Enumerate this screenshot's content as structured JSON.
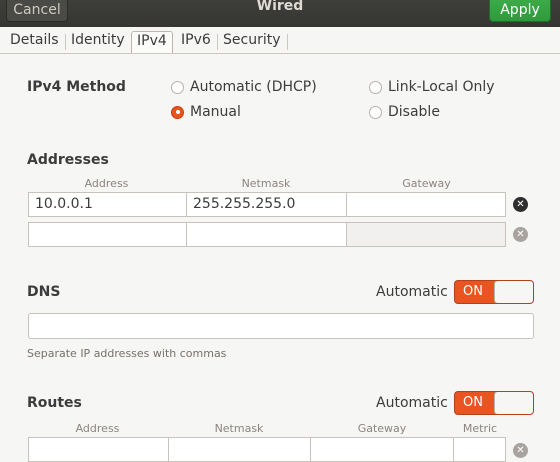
{
  "header": {
    "cancel_label": "Cancel",
    "title": "Wired",
    "apply_label": "Apply"
  },
  "tabs": [
    {
      "label": "Details"
    },
    {
      "label": "Identity"
    },
    {
      "label": "IPv4"
    },
    {
      "label": "IPv6"
    },
    {
      "label": "Security"
    }
  ],
  "active_tab": "IPv4",
  "ipv4_method": {
    "label": "IPv4 Method",
    "options": [
      {
        "label": "Automatic (DHCP)",
        "checked": false
      },
      {
        "label": "Link-Local Only",
        "checked": false
      },
      {
        "label": "Manual",
        "checked": true
      },
      {
        "label": "Disable",
        "checked": false
      }
    ]
  },
  "addresses": {
    "title": "Addresses",
    "columns": [
      "Address",
      "Netmask",
      "Gateway"
    ],
    "rows": [
      {
        "address": "10.0.0.1",
        "netmask": "255.255.255.0",
        "gateway": ""
      },
      {
        "address": "",
        "netmask": "",
        "gateway": ""
      }
    ]
  },
  "dns": {
    "title": "DNS",
    "automatic_label": "Automatic",
    "toggle_label": "ON",
    "value": "",
    "hint": "Separate IP addresses with commas"
  },
  "routes": {
    "title": "Routes",
    "automatic_label": "Automatic",
    "toggle_label": "ON",
    "columns": [
      "Address",
      "Netmask",
      "Gateway",
      "Metric"
    ]
  },
  "colors": {
    "accent": "#e95420",
    "apply_green": "#3fb04b",
    "header_bg": "#3e3e3b"
  },
  "icons": {
    "clear": "clear-icon"
  }
}
